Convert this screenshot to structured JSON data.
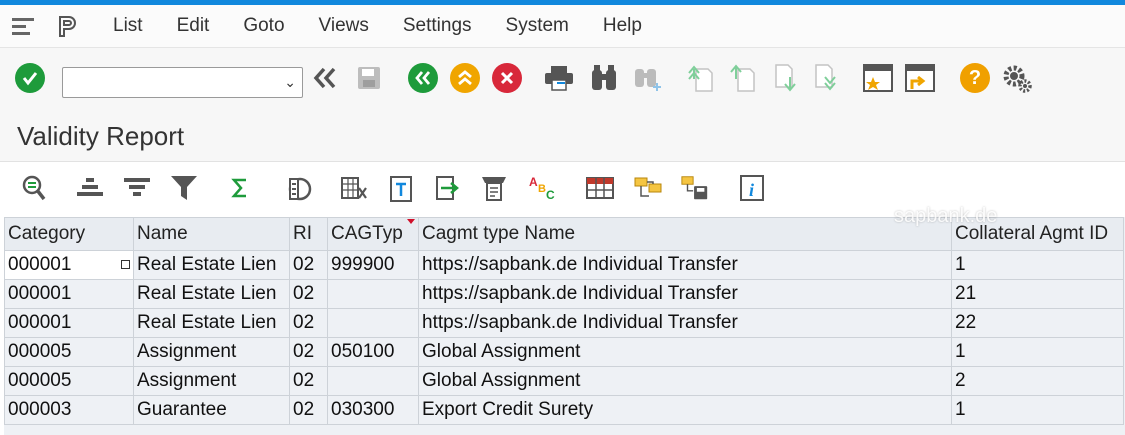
{
  "menu": {
    "items": [
      {
        "label": "List"
      },
      {
        "label": "Edit"
      },
      {
        "label": "Goto"
      },
      {
        "label": "Views"
      },
      {
        "label": "Settings"
      },
      {
        "label": "System"
      },
      {
        "label": "Help"
      }
    ]
  },
  "command_field": {
    "value": "",
    "placeholder": ""
  },
  "page": {
    "title": "Validity Report"
  },
  "watermark": "sapbank.de",
  "colors": {
    "accent_blue": "#1188dd",
    "confirm_green": "#1e9b3b",
    "nav_orange": "#f0a500",
    "cancel_red": "#d8283a",
    "help_orange": "#f0a000"
  },
  "table": {
    "columns": [
      "Category",
      "Name",
      "RI",
      "CAGTyp",
      "Cagmt type Name",
      "Collateral Agmt ID"
    ],
    "rows": [
      {
        "category": "000001",
        "name": "Real Estate Lien",
        "ri": "02",
        "cagtyp": "999900",
        "cagmt_type_name": "https://sapbank.de Individual Transfer",
        "collateral_id": "1"
      },
      {
        "category": "000001",
        "name": "Real Estate Lien",
        "ri": "02",
        "cagtyp": "",
        "cagmt_type_name": "https://sapbank.de Individual Transfer",
        "collateral_id": "21"
      },
      {
        "category": "000001",
        "name": "Real Estate Lien",
        "ri": "02",
        "cagtyp": "",
        "cagmt_type_name": "https://sapbank.de Individual Transfer",
        "collateral_id": "22"
      },
      {
        "category": "000005",
        "name": "Assignment",
        "ri": "02",
        "cagtyp": "050100",
        "cagmt_type_name": "Global Assignment",
        "collateral_id": "1"
      },
      {
        "category": "000005",
        "name": "Assignment",
        "ri": "02",
        "cagtyp": "",
        "cagmt_type_name": "Global Assignment",
        "collateral_id": "2"
      },
      {
        "category": "000003",
        "name": "Guarantee",
        "ri": "02",
        "cagtyp": "030300",
        "cagmt_type_name": "Export Credit Surety",
        "collateral_id": "1"
      }
    ]
  }
}
